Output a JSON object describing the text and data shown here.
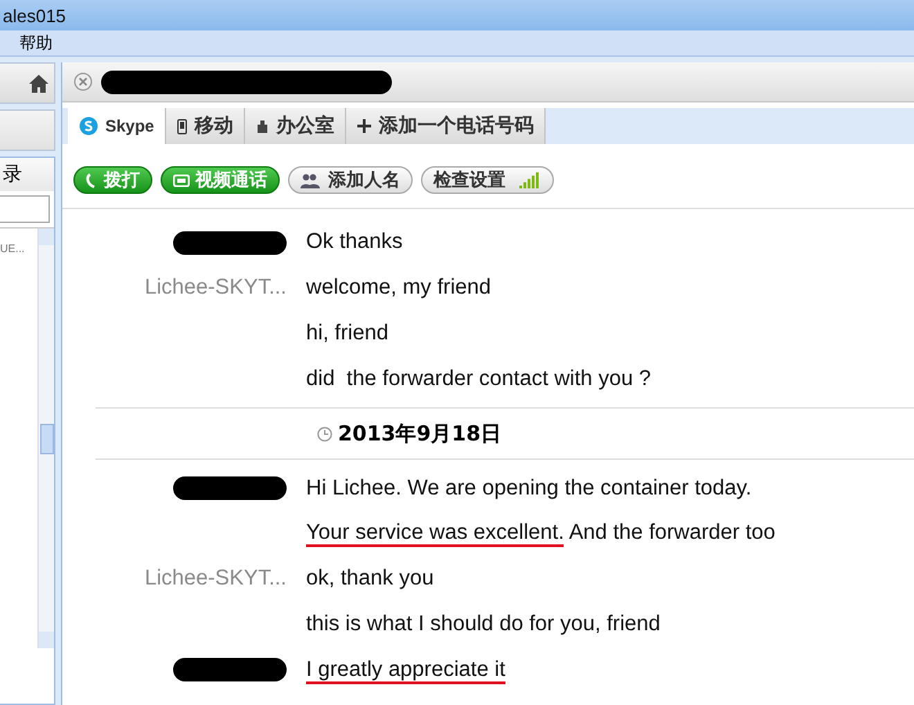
{
  "window": {
    "title": "ales015"
  },
  "menu": [
    "帮助"
  ],
  "sidebar": {
    "panel_title": "录",
    "items": [
      {
        "snippet": "UE..."
      }
    ]
  },
  "contact_header": {
    "name_redacted": true
  },
  "tabs": [
    {
      "label": "Skype",
      "kind": "skype",
      "selected": true
    },
    {
      "label": "移动",
      "kind": "mobile",
      "selected": false
    },
    {
      "label": "办公室",
      "kind": "office",
      "selected": false
    },
    {
      "label": "添加一个电话号码",
      "kind": "add",
      "selected": false
    }
  ],
  "actions": [
    {
      "label": "拨打",
      "kind": "call"
    },
    {
      "label": "视频通话",
      "kind": "video"
    },
    {
      "label": "添加人名",
      "kind": "add-people"
    },
    {
      "label": "检查设置",
      "kind": "settings"
    }
  ],
  "chat": [
    {
      "kind": "message",
      "sender_redacted": true,
      "parts": [
        {
          "text": "Ok thanks",
          "marked": false
        }
      ]
    },
    {
      "kind": "message",
      "sender": "Lichee-SKYT...",
      "parts": [
        {
          "text": "welcome, my friend",
          "marked": false
        }
      ]
    },
    {
      "kind": "message",
      "parts": [
        {
          "text": "hi, friend",
          "marked": false
        }
      ]
    },
    {
      "kind": "message",
      "parts": [
        {
          "text": "did  the forwarder contact with you ?",
          "marked": false
        }
      ]
    },
    {
      "kind": "date",
      "text": "2013年9月18日"
    },
    {
      "kind": "message",
      "sender_redacted": true,
      "parts": [
        {
          "text": "Hi Lichee. We are opening the container today.",
          "marked": false
        }
      ]
    },
    {
      "kind": "message",
      "parts": [
        {
          "text": "Your service was excellent.",
          "marked": true
        },
        {
          "text": " And the forwarder too",
          "marked": false
        }
      ]
    },
    {
      "kind": "message",
      "sender": "Lichee-SKYT...",
      "parts": [
        {
          "text": "ok, thank you",
          "marked": false
        }
      ]
    },
    {
      "kind": "message",
      "parts": [
        {
          "text": "this is what I should do for you, friend",
          "marked": false
        }
      ]
    },
    {
      "kind": "message",
      "sender_redacted": true,
      "parts": [
        {
          "text": "I greatly appreciate it",
          "marked": true
        }
      ]
    }
  ]
}
